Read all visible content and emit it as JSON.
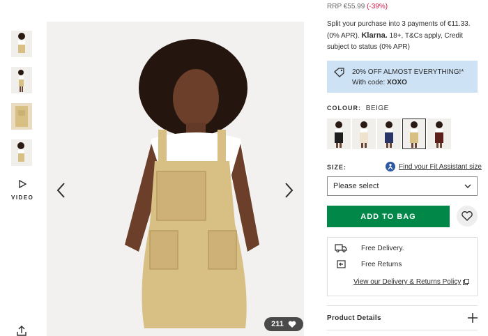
{
  "price": {
    "rrp_label": "RRP €55.99",
    "discount": "(-39%)"
  },
  "klarna": {
    "before": "Split your purchase into 3 payments of €11.33. (0% APR).",
    "brand": "Klarna.",
    "after": "18+, T&Cs apply, Credit subject to status (0% APR)"
  },
  "promo": {
    "line1": "20% OFF ALMOST EVERYTHING!*",
    "line2_prefix": "With code:",
    "code": "XOXO"
  },
  "colour": {
    "label": "COLOUR:",
    "value": "BEIGE",
    "swatches": [
      {
        "name": "black",
        "color": "#1e1e1e"
      },
      {
        "name": "cream",
        "color": "#efe3cf"
      },
      {
        "name": "navy",
        "color": "#2a3566"
      },
      {
        "name": "beige",
        "color": "#d8bf84"
      },
      {
        "name": "burgundy",
        "color": "#5b1f1c"
      }
    ],
    "selected_index": 3
  },
  "size": {
    "label": "SIZE:",
    "fit_assistant": "Find your Fit Assistant size",
    "select_value": "Please select"
  },
  "actions": {
    "add_to_bag": "ADD TO BAG"
  },
  "delivery": {
    "free_delivery": "Free Delivery.",
    "free_returns": "Free Returns",
    "policy_link": "View our Delivery & Returns Policy"
  },
  "details": {
    "title": "Product Details"
  },
  "gallery": {
    "video_label": "VIDEO",
    "likes": "211"
  },
  "colors": {
    "accent_green": "#018849",
    "promo_bg": "#cde2f5",
    "discount_red": "#d01345"
  }
}
